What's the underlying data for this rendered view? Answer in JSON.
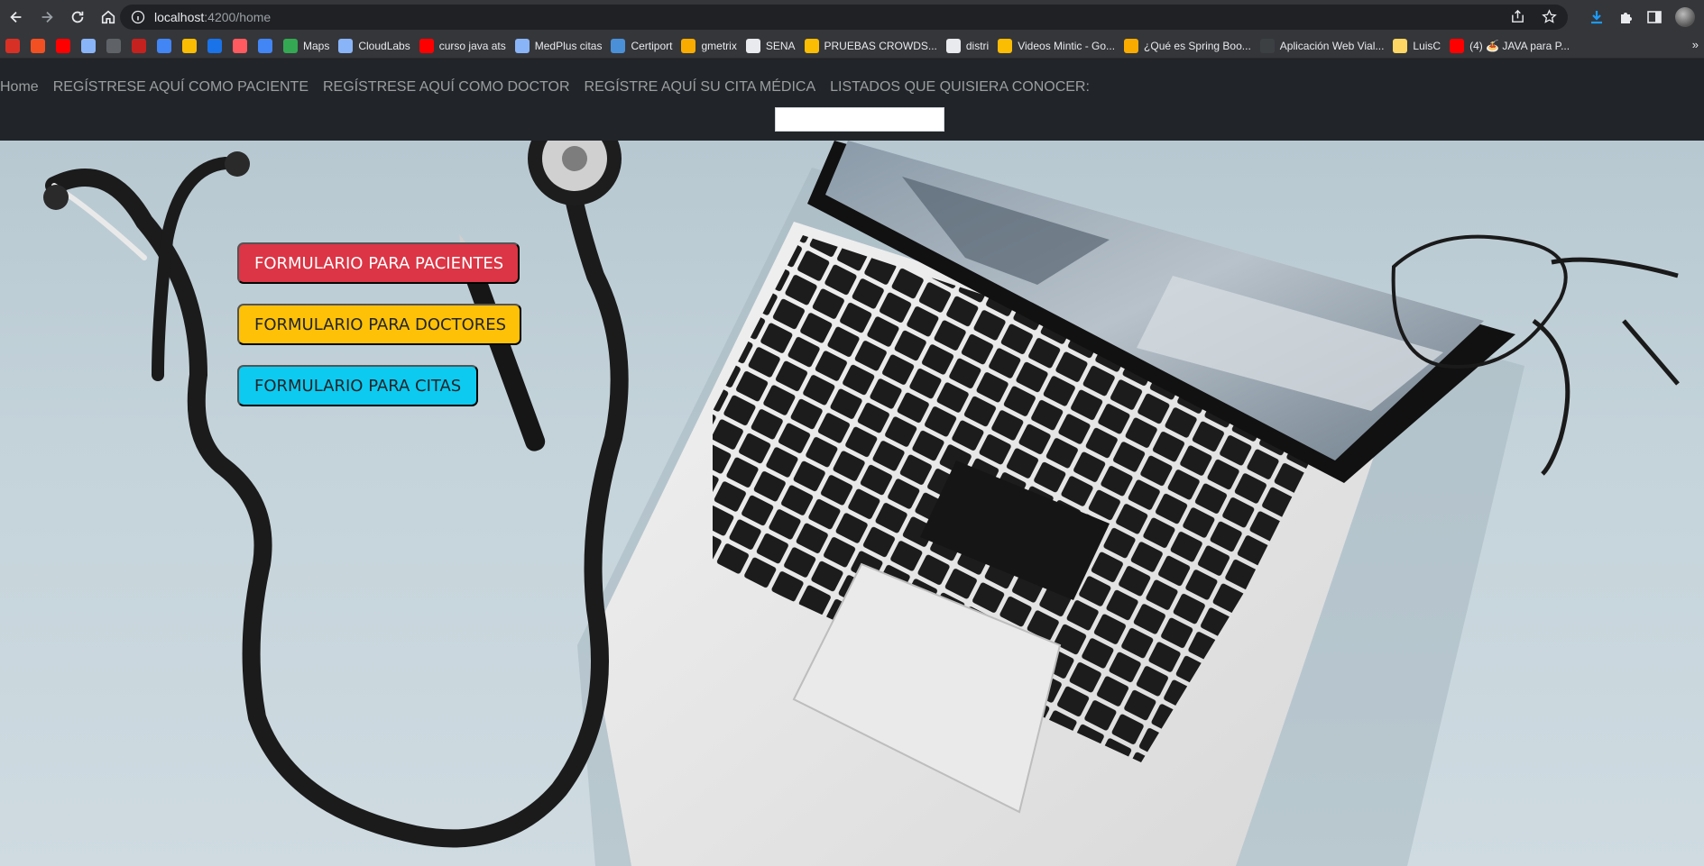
{
  "browser": {
    "url_host": "localhost",
    "url_path": ":4200/home",
    "bookmarks": [
      {
        "label": "",
        "icon": "gmail-icon",
        "color": "#d93025"
      },
      {
        "label": "",
        "icon": "microsoft-icon",
        "color": "#f25022"
      },
      {
        "label": "",
        "icon": "youtube-icon",
        "color": "#ff0000"
      },
      {
        "label": "",
        "icon": "app-icon",
        "color": "#8ab4f8"
      },
      {
        "label": "",
        "icon": "number-2-icon",
        "color": "#5f6368"
      },
      {
        "label": "",
        "icon": "el-tiempo-icon",
        "color": "#c5221f"
      },
      {
        "label": "",
        "icon": "et-icon",
        "color": "#4285f4"
      },
      {
        "label": "",
        "icon": "drive-icon",
        "color": "#fbbc04"
      },
      {
        "label": "",
        "icon": "edge-icon",
        "color": "#1a73e8"
      },
      {
        "label": "",
        "icon": "airbnb-icon",
        "color": "#ff5a5f"
      },
      {
        "label": "",
        "icon": "triangle-icon",
        "color": "#4285f4"
      },
      {
        "label": "Maps",
        "icon": "maps-icon",
        "color": "#34a853"
      },
      {
        "label": "CloudLabs",
        "icon": "cloud-icon",
        "color": "#8ab4f8"
      },
      {
        "label": "curso java ats",
        "icon": "youtube-icon",
        "color": "#ff0000"
      },
      {
        "label": "MedPlus citas",
        "icon": "medplus-icon",
        "color": "#8ab4f8"
      },
      {
        "label": "Certiport",
        "icon": "certiport-icon",
        "color": "#4a90d9"
      },
      {
        "label": "gmetrix",
        "icon": "gmetrix-icon",
        "color": "#f9ab00"
      },
      {
        "label": "SENA",
        "icon": "sena-icon",
        "color": "#e8eaed"
      },
      {
        "label": "PRUEBAS CROWDS...",
        "icon": "crowd-icon",
        "color": "#fbbc04"
      },
      {
        "label": "distri",
        "icon": "doc-icon",
        "color": "#e8eaed"
      },
      {
        "label": "Videos Mintic - Go...",
        "icon": "drive-icon",
        "color": "#fbbc04"
      },
      {
        "label": "¿Qué es Spring Boo...",
        "icon": "diamond-icon",
        "color": "#f9ab00"
      },
      {
        "label": "Aplicación Web Vial...",
        "icon": "web-icon",
        "color": "#3c4043"
      },
      {
        "label": "LuisC",
        "icon": "folder-icon",
        "color": "#fdd663"
      },
      {
        "label": "(4) 🍝 JAVA para P...",
        "icon": "youtube-icon",
        "color": "#ff0000"
      }
    ],
    "more_bookmarks": "»"
  },
  "navbar": {
    "links": [
      "Home",
      "REGÍSTRESE AQUÍ COMO PACIENTE",
      "REGÍSTRESE AQUÍ COMO DOCTOR",
      "REGÍSTRE AQUÍ SU CITA MÉDICA",
      "LISTADOS QUE QUISIERA CONOCER:"
    ],
    "select_value": ""
  },
  "hero": {
    "buttons": {
      "patients": "FORMULARIO PARA PACIENTES",
      "doctors": "FORMULARIO PARA DOCTORES",
      "appointments": "FORMULARIO PARA CITAS"
    }
  },
  "colors": {
    "navbar_bg": "#212529",
    "btn_danger": "#dc3545",
    "btn_warning": "#ffc107",
    "btn_info": "#0dcaf0"
  }
}
